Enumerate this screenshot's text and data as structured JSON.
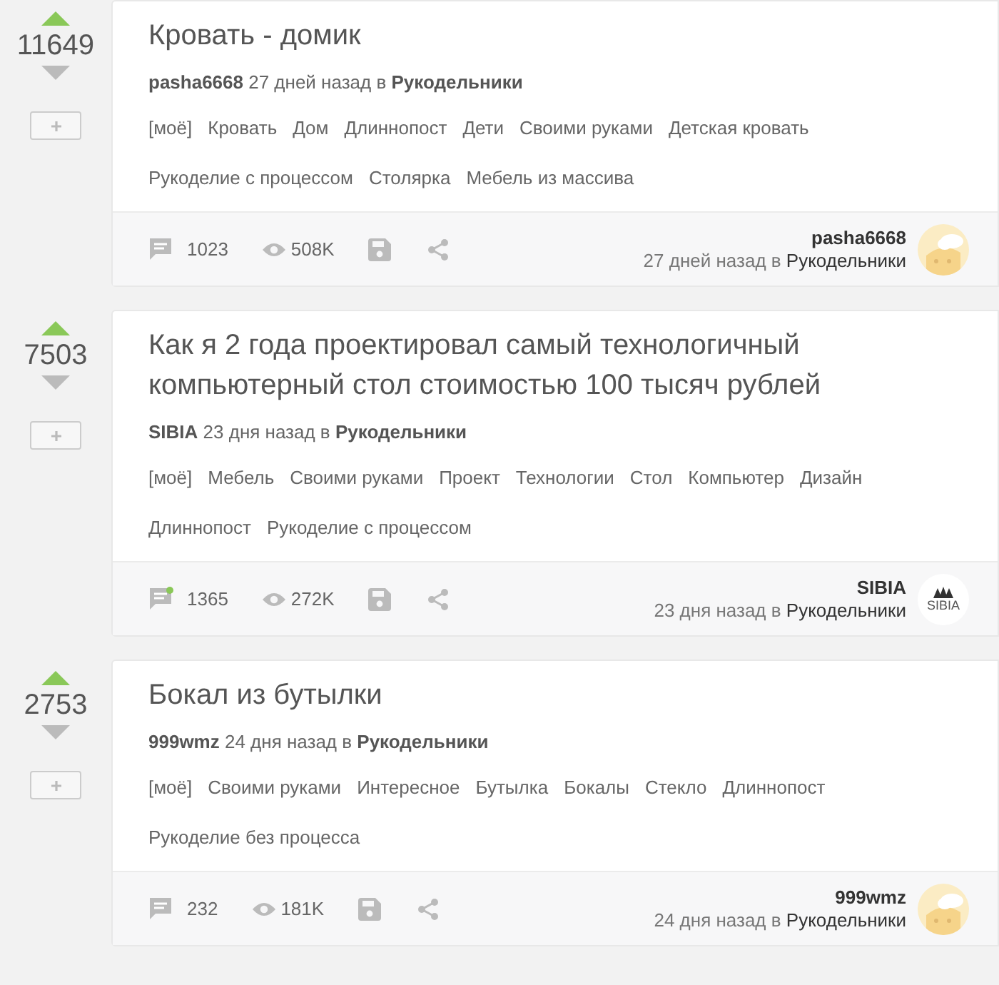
{
  "posts": [
    {
      "rating": "11649",
      "title": "Кровать - домик",
      "author": "pasha6668",
      "time": "27 дней назад в",
      "community": "Рукодельники",
      "tag_rows": [
        [
          "[моё]",
          "Кровать",
          "Дом",
          "Длиннопост",
          "Дети",
          "Своими руками",
          "Детская кровать"
        ],
        [
          "Рукоделие с процессом",
          "Столярка",
          "Мебель из массива"
        ]
      ],
      "comments": "1023",
      "new_comments": false,
      "views": "508K",
      "footer_author": "pasha6668",
      "footer_time": "27 дней назад в",
      "footer_community": "Рукодельники",
      "avatar": {
        "kind": "picture"
      }
    },
    {
      "rating": "7503",
      "title": "Как я 2 года проектировал самый технологичный компьютерный стол стоимостью 100 тысяч рублей",
      "author": "SIBIA",
      "time": "23 дня назад в",
      "community": "Рукодельники",
      "tag_rows": [
        [
          "[моё]",
          "Мебель",
          "Своими руками",
          "Проект",
          "Технологии",
          "Стол",
          "Компьютер",
          "Дизайн"
        ],
        [
          "Длиннопост",
          "Рукоделие с процессом"
        ]
      ],
      "comments": "1365",
      "new_comments": true,
      "views": "272K",
      "footer_author": "SIBIA",
      "footer_time": "23 дня назад в",
      "footer_community": "Рукодельники",
      "avatar": {
        "kind": "logo",
        "text": "SIBIA"
      }
    },
    {
      "rating": "2753",
      "title": "Бокал из бутылки",
      "author": "999wmz",
      "time": "24 дня назад в",
      "community": "Рукодельники",
      "tag_rows": [
        [
          "[моё]",
          "Своими руками",
          "Интересное",
          "Бутылка",
          "Бокалы",
          "Стекло",
          "Длиннопост"
        ],
        [
          "Рукоделие без процесса"
        ]
      ],
      "comments": "232",
      "new_comments": false,
      "views": "181K",
      "footer_author": "999wmz",
      "footer_time": "24 дня назад в",
      "footer_community": "Рукодельники",
      "avatar": {
        "kind": "picture"
      }
    }
  ]
}
